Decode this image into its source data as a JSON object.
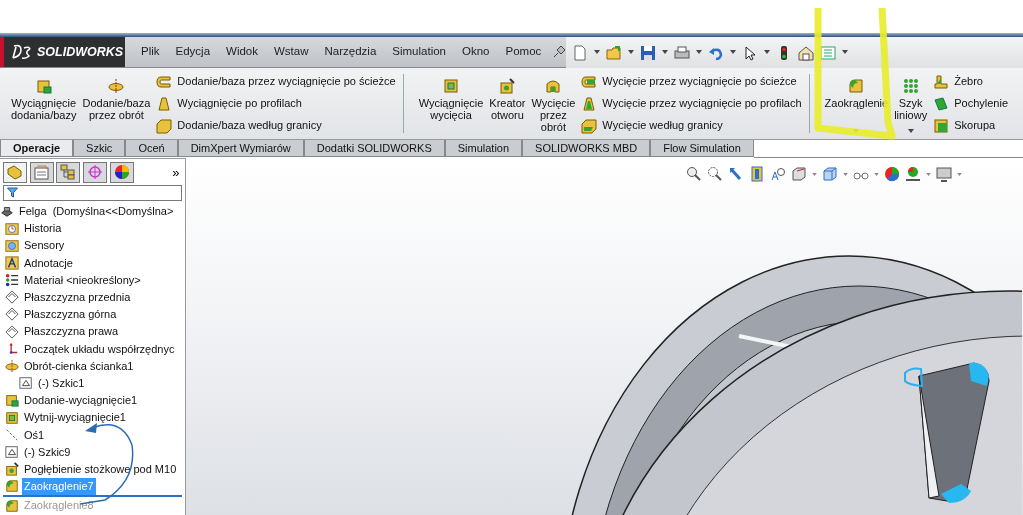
{
  "app": {
    "logo_text": "SOLIDWORKS"
  },
  "menu": [
    "Plik",
    "Edycja",
    "Widok",
    "Wstaw",
    "Narzędzia",
    "Simulation",
    "Okno",
    "Pomoc"
  ],
  "ribbon": {
    "groups": [
      {
        "large": [
          {
            "label": "Wyciągnięcie\ndodania/bazy",
            "kind": "extrude",
            "dropdown": false
          },
          {
            "label": "Dodanie/baza\nprzez obrót",
            "kind": "revolve",
            "dropdown": false
          }
        ],
        "small": [
          {
            "label": "Dodanie/baza przez wyciągnięcie po ścieżce",
            "kind": "sweep"
          },
          {
            "label": "Wyciągnięcie po profilach",
            "kind": "loft"
          },
          {
            "label": "Dodanie/baza według granicy",
            "kind": "boundary"
          }
        ]
      },
      {
        "large": [
          {
            "label": "Wyciągnięcie\nwycięcia",
            "kind": "cut",
            "dropdown": false
          },
          {
            "label": "Kreator\notworu",
            "kind": "hole",
            "dropdown": false
          },
          {
            "label": "Wycięcie\nprzez\nobrót",
            "kind": "revcut",
            "dropdown": false
          }
        ],
        "small": [
          {
            "label": "Wycięcie przez wyciągnięcie po ścieżce",
            "kind": "sweepcut"
          },
          {
            "label": "Wycięcie przez wyciągnięcie po profilach",
            "kind": "loftcut"
          },
          {
            "label": "Wycięcie według granicy",
            "kind": "boundarycut"
          }
        ]
      },
      {
        "large": [
          {
            "label": "Zaokrąglenie",
            "kind": "fillet",
            "dropdown": true
          },
          {
            "label": "Szyk\nliniowy",
            "kind": "pattern",
            "dropdown": true
          }
        ],
        "small": [
          {
            "label": "Żebro",
            "kind": "rib"
          },
          {
            "label": "Pochylenie",
            "kind": "draft"
          },
          {
            "label": "Skorupa",
            "kind": "shell"
          }
        ]
      }
    ]
  },
  "tabs": [
    {
      "label": "Operacje",
      "selected": true
    },
    {
      "label": "Szkic",
      "selected": false
    },
    {
      "label": "Oceń",
      "selected": false
    },
    {
      "label": "DimXpert Wymiarów",
      "selected": false
    },
    {
      "label": "Dodatki SOLIDWORKS",
      "selected": false
    },
    {
      "label": "Simulation",
      "selected": false
    },
    {
      "label": "SOLIDWORKS MBD",
      "selected": false
    },
    {
      "label": "Flow Simulation",
      "selected": false
    }
  ],
  "panel_tabs": [
    {
      "kind": "tree",
      "selected": true
    },
    {
      "kind": "property",
      "selected": false
    },
    {
      "kind": "config",
      "selected": false
    },
    {
      "kind": "dimxpert",
      "selected": false
    },
    {
      "kind": "display",
      "selected": false
    }
  ],
  "panel_more": "»",
  "tree": {
    "label": "Felga  (Domyślna<<Domyślna>",
    "kind": "part",
    "selected": false,
    "disabled": false,
    "children": [
      {
        "label": "Historia",
        "kind": "history",
        "selected": false,
        "disabled": false
      },
      {
        "label": "Sensory",
        "kind": "sensors",
        "selected": false,
        "disabled": false
      },
      {
        "label": "Adnotacje",
        "kind": "annotations",
        "selected": false,
        "disabled": false
      },
      {
        "label": "Materiał <nieokreślony>",
        "kind": "material",
        "selected": false,
        "disabled": false
      },
      {
        "label": "Płaszczyzna przednia",
        "kind": "plane",
        "selected": false,
        "disabled": false
      },
      {
        "label": "Płaszczyzna górna",
        "kind": "plane",
        "selected": false,
        "disabled": false
      },
      {
        "label": "Płaszczyzna prawa",
        "kind": "plane",
        "selected": false,
        "disabled": false
      },
      {
        "label": "Początek układu współrzędnyc",
        "kind": "origin",
        "selected": false,
        "disabled": false
      },
      {
        "label": "Obrót-cienka ścianka1",
        "kind": "revolve",
        "selected": false,
        "disabled": false,
        "children": [
          {
            "label": "(-) Szkic1",
            "kind": "sketch",
            "selected": false,
            "disabled": false
          }
        ]
      },
      {
        "label": "Dodanie-wyciągnięcie1",
        "kind": "extrude",
        "selected": false,
        "disabled": false
      },
      {
        "label": "Wytnij-wyciągnięcie1",
        "kind": "cut",
        "selected": false,
        "disabled": false
      },
      {
        "label": "Oś1",
        "kind": "axis",
        "selected": false,
        "disabled": false
      },
      {
        "label": "(-) Szkic9",
        "kind": "sketch",
        "selected": false,
        "disabled": false
      },
      {
        "label": "Pogłębienie stożkowe pod M10",
        "kind": "hole",
        "selected": false,
        "disabled": false
      },
      {
        "label": "Zaokrąglenie7",
        "kind": "fillet",
        "selected": true,
        "disabled": false
      },
      {
        "label": "Zaokrąglenie8",
        "kind": "fillet",
        "selected": false,
        "disabled": true
      }
    ]
  }
}
